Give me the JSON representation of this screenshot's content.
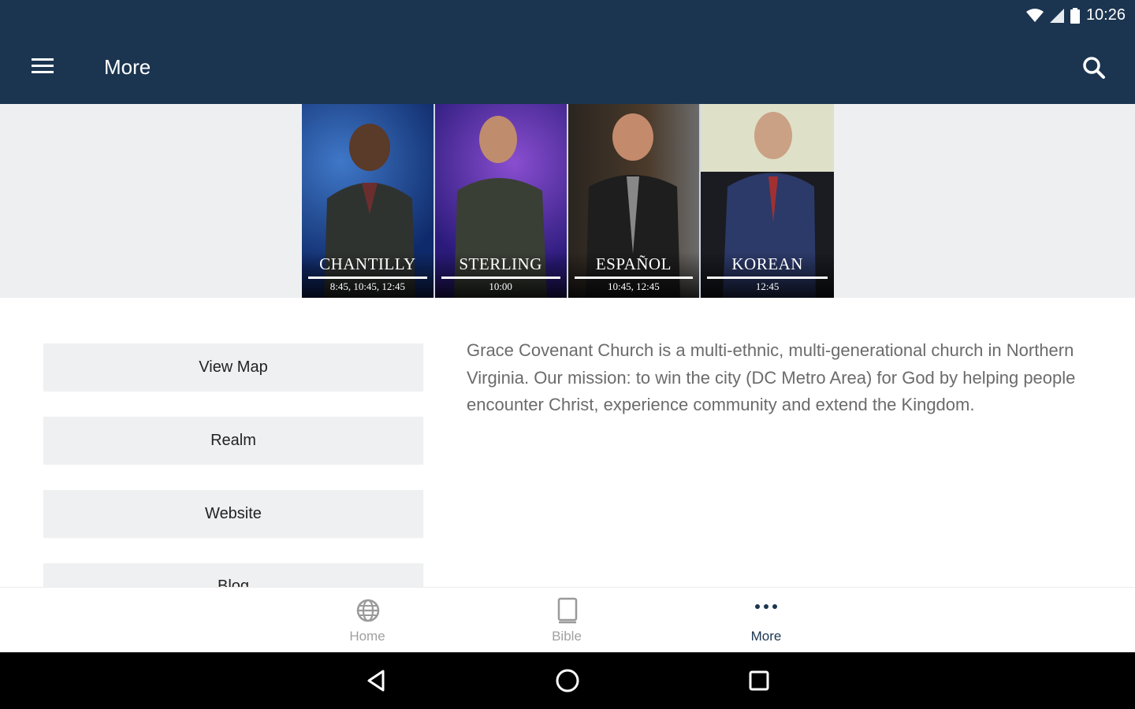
{
  "status_bar": {
    "time": "10:26"
  },
  "app_bar": {
    "title": "More"
  },
  "campuses": [
    {
      "name": "CHANTILLY",
      "times": "8:45, 10:45, 12:45"
    },
    {
      "name": "STERLING",
      "times": "10:00"
    },
    {
      "name": "ESPAÑOL",
      "times": "10:45, 12:45"
    },
    {
      "name": "KOREAN",
      "times": "12:45"
    }
  ],
  "actions": [
    {
      "label": "View Map"
    },
    {
      "label": "Realm"
    },
    {
      "label": "Website"
    },
    {
      "label": "Blog"
    }
  ],
  "description": "Grace Covenant Church is a multi-ethnic, multi-generational church in Northern Virginia. Our mission: to win the city (DC Metro Area) for God by helping people encounter Christ, experience community and extend the Kingdom.",
  "bottom_nav": [
    {
      "label": "Home",
      "icon": "globe-icon",
      "active": false
    },
    {
      "label": "Bible",
      "icon": "book-icon",
      "active": false
    },
    {
      "label": "More",
      "icon": "more-dots-icon",
      "active": true
    }
  ],
  "colors": {
    "primary": "#1b3550",
    "button_bg": "#eff0f1",
    "banner_bg": "#eeeff0",
    "text_muted": "#6b6b6b"
  }
}
